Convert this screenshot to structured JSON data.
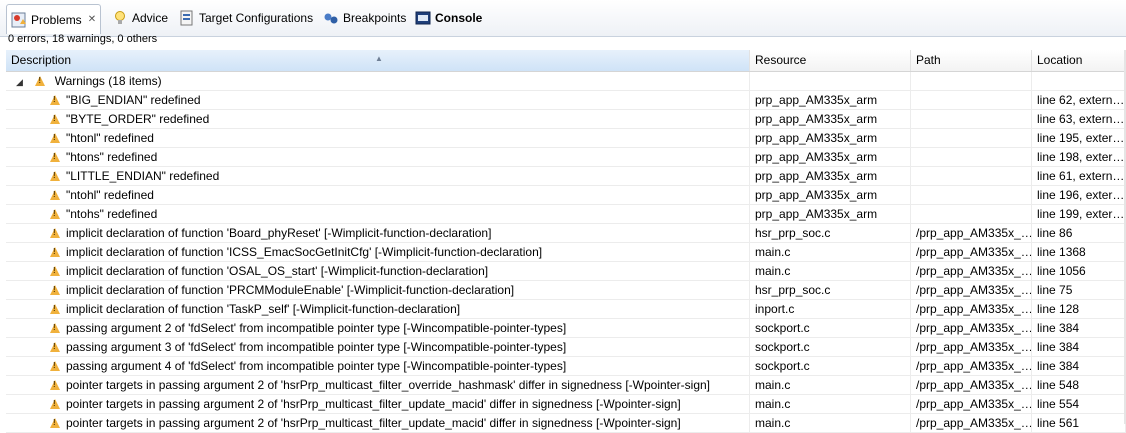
{
  "tabs": [
    {
      "label": "Problems",
      "icon": "problems-icon",
      "active": true
    },
    {
      "label": "Advice",
      "icon": "lightbulb-icon"
    },
    {
      "label": "Target Configurations",
      "icon": "target-config-icon"
    },
    {
      "label": "Breakpoints",
      "icon": "breakpoints-icon"
    },
    {
      "label": "Console",
      "icon": "console-icon"
    }
  ],
  "summary": "0 errors, 18 warnings, 0 others",
  "columns": {
    "description": "Description",
    "resource": "Resource",
    "path": "Path",
    "location": "Location"
  },
  "group": {
    "label": "Warnings (18 items)"
  },
  "rows": [
    {
      "description": "\"BIG_ENDIAN\" redefined",
      "resource": "prp_app_AM335x_arm",
      "path": "",
      "location": "line 62, extern…"
    },
    {
      "description": "\"BYTE_ORDER\" redefined",
      "resource": "prp_app_AM335x_arm",
      "path": "",
      "location": "line 63, extern…"
    },
    {
      "description": "\"htonl\" redefined",
      "resource": "prp_app_AM335x_arm",
      "path": "",
      "location": "line 195, exter…"
    },
    {
      "description": "\"htons\" redefined",
      "resource": "prp_app_AM335x_arm",
      "path": "",
      "location": "line 198, exter…"
    },
    {
      "description": "\"LITTLE_ENDIAN\" redefined",
      "resource": "prp_app_AM335x_arm",
      "path": "",
      "location": "line 61, extern…"
    },
    {
      "description": "\"ntohl\" redefined",
      "resource": "prp_app_AM335x_arm",
      "path": "",
      "location": "line 196, exter…"
    },
    {
      "description": "\"ntohs\" redefined",
      "resource": "prp_app_AM335x_arm",
      "path": "",
      "location": "line 199, exter…"
    },
    {
      "description": "implicit declaration of function 'Board_phyReset' [-Wimplicit-function-declaration]",
      "resource": "hsr_prp_soc.c",
      "path": "/prp_app_AM335x_…",
      "location": "line 86"
    },
    {
      "description": "implicit declaration of function 'ICSS_EmacSocGetInitCfg' [-Wimplicit-function-declaration]",
      "resource": "main.c",
      "path": "/prp_app_AM335x_…",
      "location": "line 1368"
    },
    {
      "description": "implicit declaration of function 'OSAL_OS_start' [-Wimplicit-function-declaration]",
      "resource": "main.c",
      "path": "/prp_app_AM335x_…",
      "location": "line 1056"
    },
    {
      "description": "implicit declaration of function 'PRCMModuleEnable' [-Wimplicit-function-declaration]",
      "resource": "hsr_prp_soc.c",
      "path": "/prp_app_AM335x_…",
      "location": "line 75"
    },
    {
      "description": "implicit declaration of function 'TaskP_self' [-Wimplicit-function-declaration]",
      "resource": "inport.c",
      "path": "/prp_app_AM335x_…",
      "location": "line 128"
    },
    {
      "description": "passing argument 2 of 'fdSelect' from incompatible pointer type [-Wincompatible-pointer-types]",
      "resource": "sockport.c",
      "path": "/prp_app_AM335x_…",
      "location": "line 384"
    },
    {
      "description": "passing argument 3 of 'fdSelect' from incompatible pointer type [-Wincompatible-pointer-types]",
      "resource": "sockport.c",
      "path": "/prp_app_AM335x_…",
      "location": "line 384"
    },
    {
      "description": "passing argument 4 of 'fdSelect' from incompatible pointer type [-Wincompatible-pointer-types]",
      "resource": "sockport.c",
      "path": "/prp_app_AM335x_…",
      "location": "line 384"
    },
    {
      "description": "pointer targets in passing argument 2 of 'hsrPrp_multicast_filter_override_hashmask' differ in signedness [-Wpointer-sign]",
      "resource": "main.c",
      "path": "/prp_app_AM335x_…",
      "location": "line 548"
    },
    {
      "description": "pointer targets in passing argument 2 of 'hsrPrp_multicast_filter_update_macid' differ in signedness [-Wpointer-sign]",
      "resource": "main.c",
      "path": "/prp_app_AM335x_…",
      "location": "line 554"
    },
    {
      "description": "pointer targets in passing argument 2 of 'hsrPrp_multicast_filter_update_macid' differ in signedness [-Wpointer-sign]",
      "resource": "main.c",
      "path": "/prp_app_AM335x_…",
      "location": "line 561"
    }
  ],
  "colors": {
    "warning": "#f0b13c",
    "header_sort": "#cfe3f7"
  }
}
